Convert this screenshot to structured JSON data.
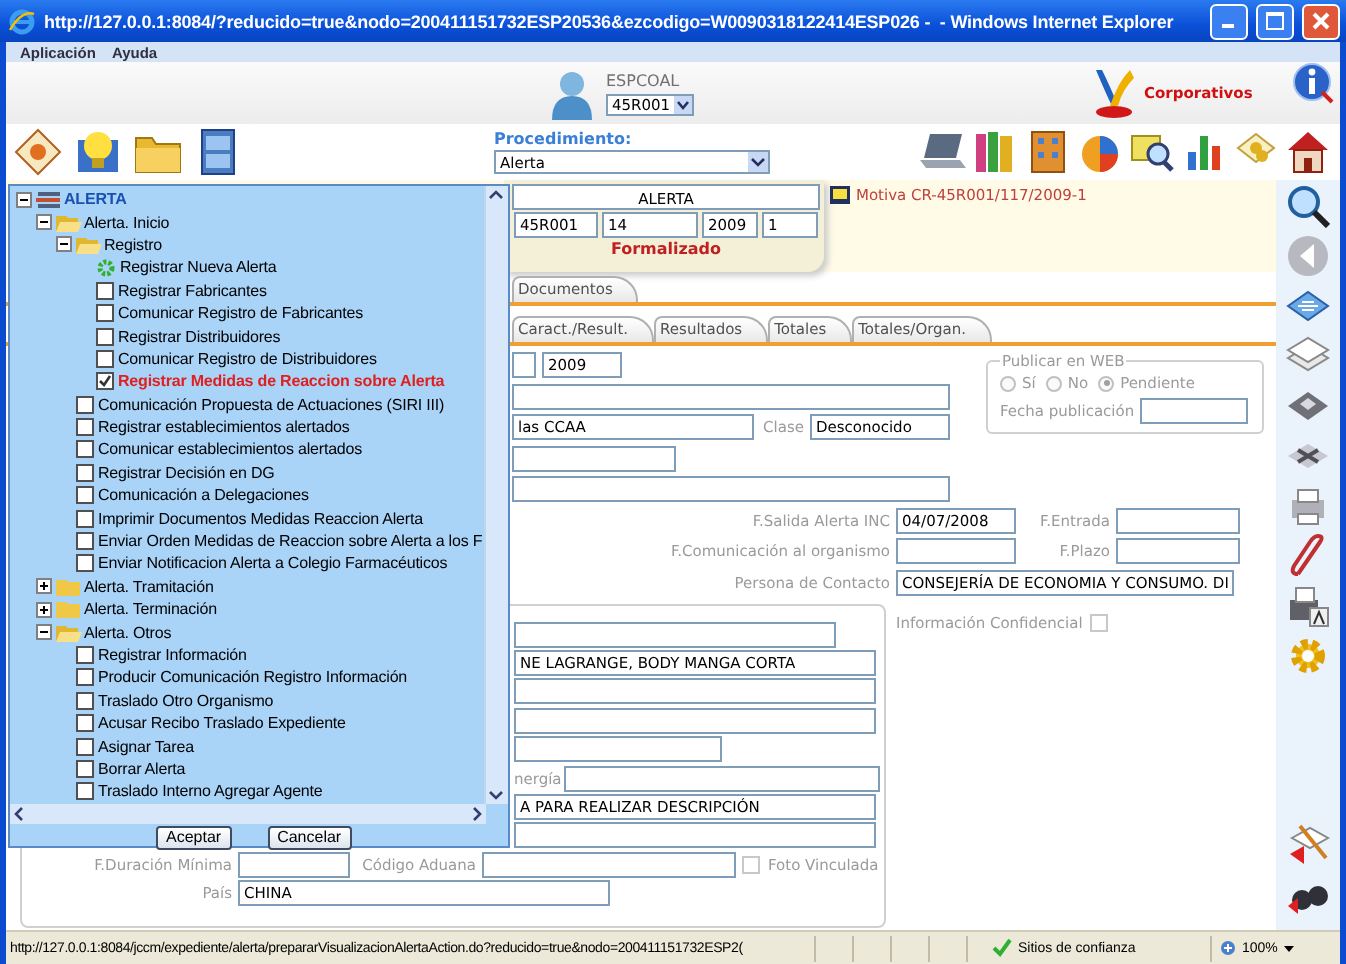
{
  "window": {
    "title": "http://127.0.0.1:8084/?reducido=true&nodo=200411151732ESP20536&ezcodigo=W0090318122414ESP026 -  - Windows Internet Explorer"
  },
  "menu": [
    "Aplicación",
    "Ayuda"
  ],
  "user": {
    "name": "ESPCOAL",
    "unit": "45R001"
  },
  "brand": "Corporativos",
  "procedure": {
    "label": "Procedimiento:",
    "value": "Alerta"
  },
  "expediente": {
    "type": "ALERTA",
    "fields": [
      "45R001",
      "14",
      "2009",
      "1"
    ],
    "status": "Formalizado",
    "motiva": "Motiva CR-45R001/117/2009-1"
  },
  "tabs_top": [
    {
      "label": "Documentos",
      "selected": false
    }
  ],
  "tabs": [
    {
      "label": "Caract./Result.",
      "selected": false
    },
    {
      "label": "Resultados",
      "selected": false
    },
    {
      "label": "Totales",
      "selected": false
    },
    {
      "label": "Totales/Organ.",
      "selected": false
    }
  ],
  "form_rows": [
    {
      "items": [
        {
          "kind": "field"
        },
        {
          "kind": "field",
          "value": "2009"
        }
      ]
    },
    {
      "items": [
        {
          "kind": "field"
        }
      ]
    },
    {
      "items": [
        {
          "kind": "field",
          "value": "las CCAA"
        },
        {
          "kind": "label",
          "text": "Clase"
        },
        {
          "kind": "field",
          "value": "Desconocido"
        }
      ]
    },
    {
      "items": [
        {
          "kind": "field"
        }
      ]
    },
    {
      "items": [
        {
          "kind": "field"
        }
      ]
    },
    {
      "items": [
        {
          "kind": "label",
          "text": "F.Salida Alerta INC"
        },
        {
          "kind": "field",
          "value": "04/07/2008"
        },
        {
          "kind": "label",
          "text": "F.Entrada"
        },
        {
          "kind": "field"
        }
      ]
    },
    {
      "items": [
        {
          "kind": "label",
          "text": "F.Comunicación al organismo"
        },
        {
          "kind": "field"
        },
        {
          "kind": "label",
          "text": "F.Plazo"
        },
        {
          "kind": "field"
        }
      ]
    },
    {
      "items": [
        {
          "kind": "label",
          "text": "Persona de Contacto"
        },
        {
          "kind": "field",
          "value": "CONSEJERÍA DE ECONOMIA Y CONSUMO. DI"
        }
      ]
    }
  ],
  "publish": {
    "legend": "Publicar en WEB",
    "options": [
      {
        "label": "Sí",
        "selected": false
      },
      {
        "label": "No",
        "selected": false
      },
      {
        "label": "Pendiente",
        "selected": true
      }
    ],
    "date_label": "Fecha publicación"
  },
  "confidential": {
    "label": "Información Confidencial",
    "checked": false
  },
  "group_rows": [
    {
      "items": [
        {
          "kind": "field"
        }
      ]
    },
    {
      "items": [
        {
          "kind": "field",
          "value": "NE LAGRANGE, BODY MANGA CORTA"
        }
      ]
    },
    {
      "items": [
        {
          "kind": "field"
        }
      ]
    },
    {
      "items": [
        {
          "kind": "field"
        }
      ]
    },
    {
      "items": [
        {
          "kind": "field"
        }
      ]
    },
    {
      "items": [
        {
          "kind": "label",
          "text": "nergía"
        },
        {
          "kind": "field"
        }
      ]
    },
    {
      "items": [
        {
          "kind": "field",
          "value": "A PARA REALIZAR DESCRIPCIÓN"
        }
      ]
    },
    {
      "items": [
        {
          "kind": "field"
        }
      ]
    },
    {
      "items": [
        {
          "kind": "label",
          "text": "F.Duración Mínima"
        },
        {
          "kind": "field"
        },
        {
          "kind": "label",
          "text": "Código Aduana"
        },
        {
          "kind": "field"
        },
        {
          "kind": "checkbox",
          "text": "Foto Vinculada",
          "checked": false
        }
      ]
    },
    {
      "items": [
        {
          "kind": "label",
          "text": "País"
        },
        {
          "kind": "field",
          "value": "CHINA"
        }
      ]
    }
  ],
  "popup": {
    "tree": [
      {
        "kind": "root",
        "label": "ALERTA",
        "expanded": true,
        "children": [
          {
            "kind": "folder",
            "label": "Alerta. Inicio",
            "expanded": true,
            "children": [
              {
                "kind": "folder",
                "label": "Registro",
                "expanded": true,
                "children": [
                  {
                    "kind": "new",
                    "label": "Registrar Nueva Alerta"
                  },
                  {
                    "kind": "task",
                    "label": "Registrar Fabricantes",
                    "checked": false,
                    "selected": false
                  },
                  {
                    "kind": "task",
                    "label": "Comunicar Registro de Fabricantes",
                    "checked": false,
                    "selected": false
                  },
                  {
                    "kind": "task",
                    "label": "Registrar Distribuidores",
                    "checked": false,
                    "selected": false
                  },
                  {
                    "kind": "task",
                    "label": "Comunicar Registro de Distribuidores",
                    "checked": false,
                    "selected": false
                  },
                  {
                    "kind": "task",
                    "label": "Registrar Medidas de Reaccion sobre Alerta",
                    "checked": true,
                    "selected": true
                  }
                ]
              },
              {
                "kind": "task",
                "label": "Comunicación Propuesta de Actuaciones (SIRI III)",
                "checked": false,
                "selected": false
              },
              {
                "kind": "task",
                "label": "Registrar establecimientos alertados",
                "checked": false,
                "selected": false
              },
              {
                "kind": "task",
                "label": "Comunicar establecimientos alertados",
                "checked": false,
                "selected": false
              },
              {
                "kind": "task",
                "label": "Registrar Decisión en DG",
                "checked": false,
                "selected": false
              },
              {
                "kind": "task",
                "label": "Comunicación a Delegaciones",
                "checked": false,
                "selected": false
              },
              {
                "kind": "task",
                "label": "Imprimir Documentos Medidas Reaccion Alerta",
                "checked": false,
                "selected": false
              },
              {
                "kind": "task",
                "label": "Enviar Orden Medidas de Reaccion sobre Alerta a los F",
                "checked": false,
                "selected": false
              },
              {
                "kind": "task",
                "label": "Enviar Notificacion Alerta a Colegio Farmacéuticos",
                "checked": false,
                "selected": false
              }
            ]
          },
          {
            "kind": "folder",
            "label": "Alerta. Tramitación",
            "expanded": false
          },
          {
            "kind": "folder",
            "label": "Alerta. Terminación",
            "expanded": false
          },
          {
            "kind": "folder",
            "label": "Alerta. Otros",
            "expanded": true,
            "children": [
              {
                "kind": "task",
                "label": "Registrar Información",
                "checked": false,
                "selected": false
              },
              {
                "kind": "task",
                "label": "Producir Comunicación Registro Información",
                "checked": false,
                "selected": false
              },
              {
                "kind": "task",
                "label": "Traslado Otro Organismo",
                "checked": false,
                "selected": false
              },
              {
                "kind": "task",
                "label": "Acusar Recibo Traslado Expediente",
                "checked": false,
                "selected": false
              },
              {
                "kind": "task",
                "label": "Asignar Tarea",
                "checked": false,
                "selected": false
              },
              {
                "kind": "task",
                "label": "Borrar Alerta",
                "checked": false,
                "selected": false
              },
              {
                "kind": "task",
                "label": "Traslado Interno Agregar Agente",
                "checked": false,
                "selected": false
              }
            ]
          }
        ]
      }
    ],
    "buttons": [
      "Aceptar",
      "Cancelar"
    ]
  },
  "status_bar": {
    "url": "http://127.0.0.1:8084/jccm/expediente/alerta/prepararVisualizacionAlertaAction.do?reducido=true&nodo=200411151732ESP2(",
    "zone": "Sitios de confianza",
    "zoom": "100%"
  }
}
